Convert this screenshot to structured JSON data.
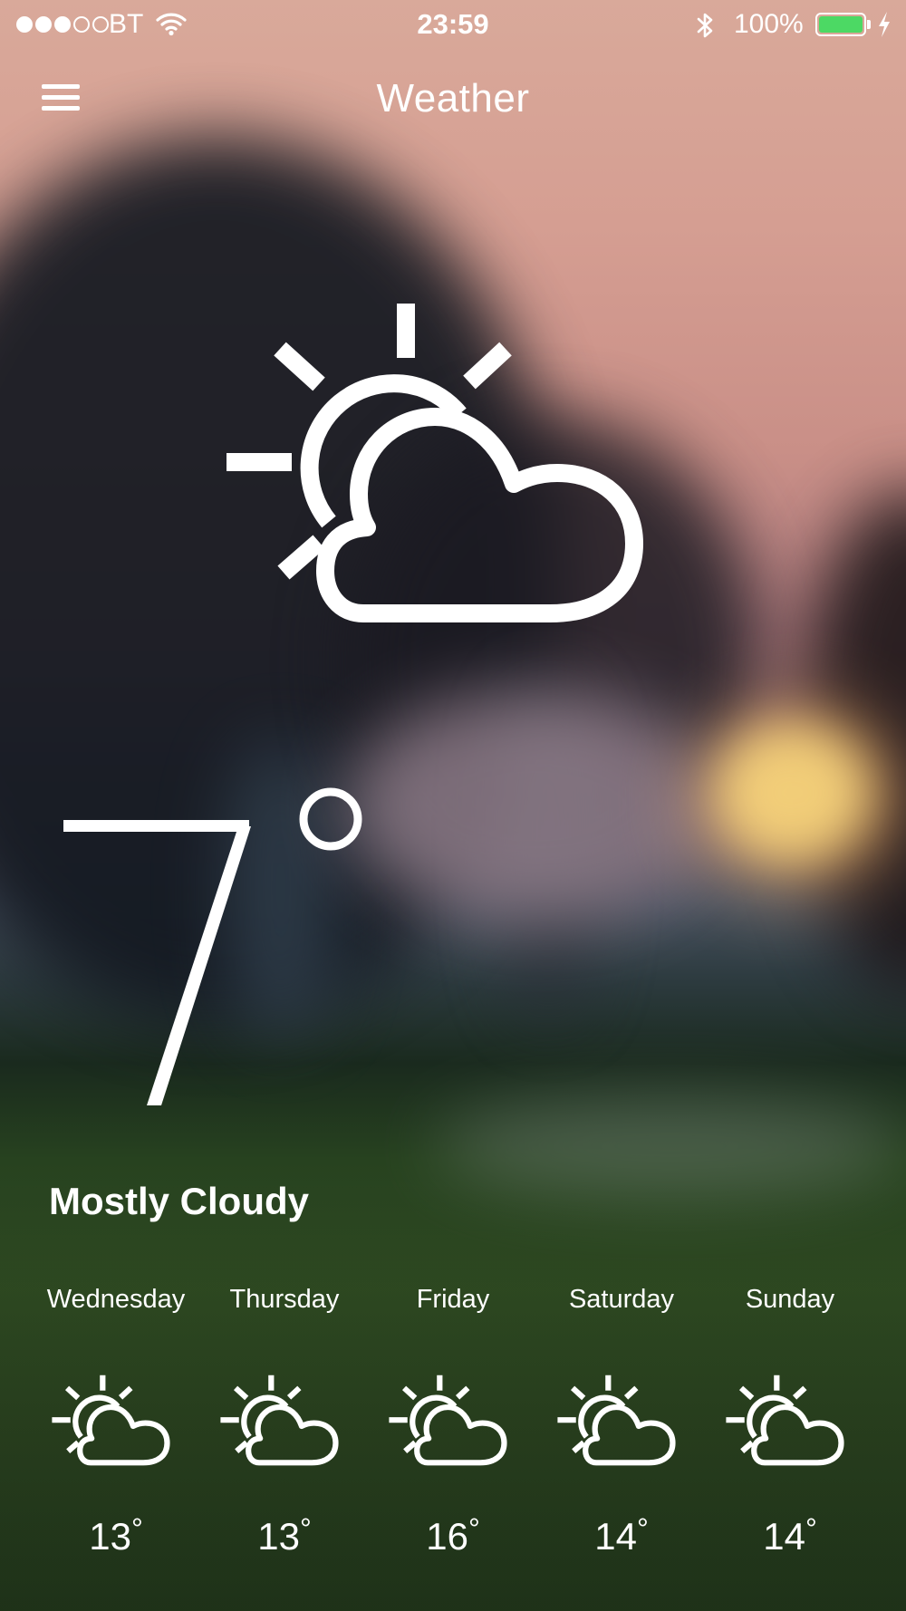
{
  "status_bar": {
    "carrier": "BT",
    "time": "23:59",
    "battery_percent": "100%",
    "battery_level": 1.0,
    "signal_strength_bars": 3,
    "signal_total_bars": 5,
    "icons": [
      "wifi-icon",
      "bluetooth-icon",
      "battery-icon",
      "charging-icon"
    ]
  },
  "nav": {
    "title": "Weather",
    "menu_icon": "hamburger-menu-icon"
  },
  "current": {
    "icon": "partly-cloudy-icon",
    "temperature": "7",
    "degree_symbol": "°",
    "condition": "Mostly Cloudy"
  },
  "forecast": [
    {
      "day": "Wednesday",
      "temp": "13",
      "icon": "partly-cloudy-icon"
    },
    {
      "day": "Thursday",
      "temp": "13",
      "icon": "partly-cloudy-icon"
    },
    {
      "day": "Friday",
      "temp": "16",
      "icon": "partly-cloudy-icon"
    },
    {
      "day": "Saturday",
      "temp": "14",
      "icon": "partly-cloudy-icon"
    },
    {
      "day": "Sunday",
      "temp": "14",
      "icon": "partly-cloudy-icon"
    }
  ],
  "colors": {
    "text": "#ffffff",
    "battery_fill": "#4cd964",
    "sky_top": "#d9a99a",
    "grass": "#2f4b22"
  }
}
